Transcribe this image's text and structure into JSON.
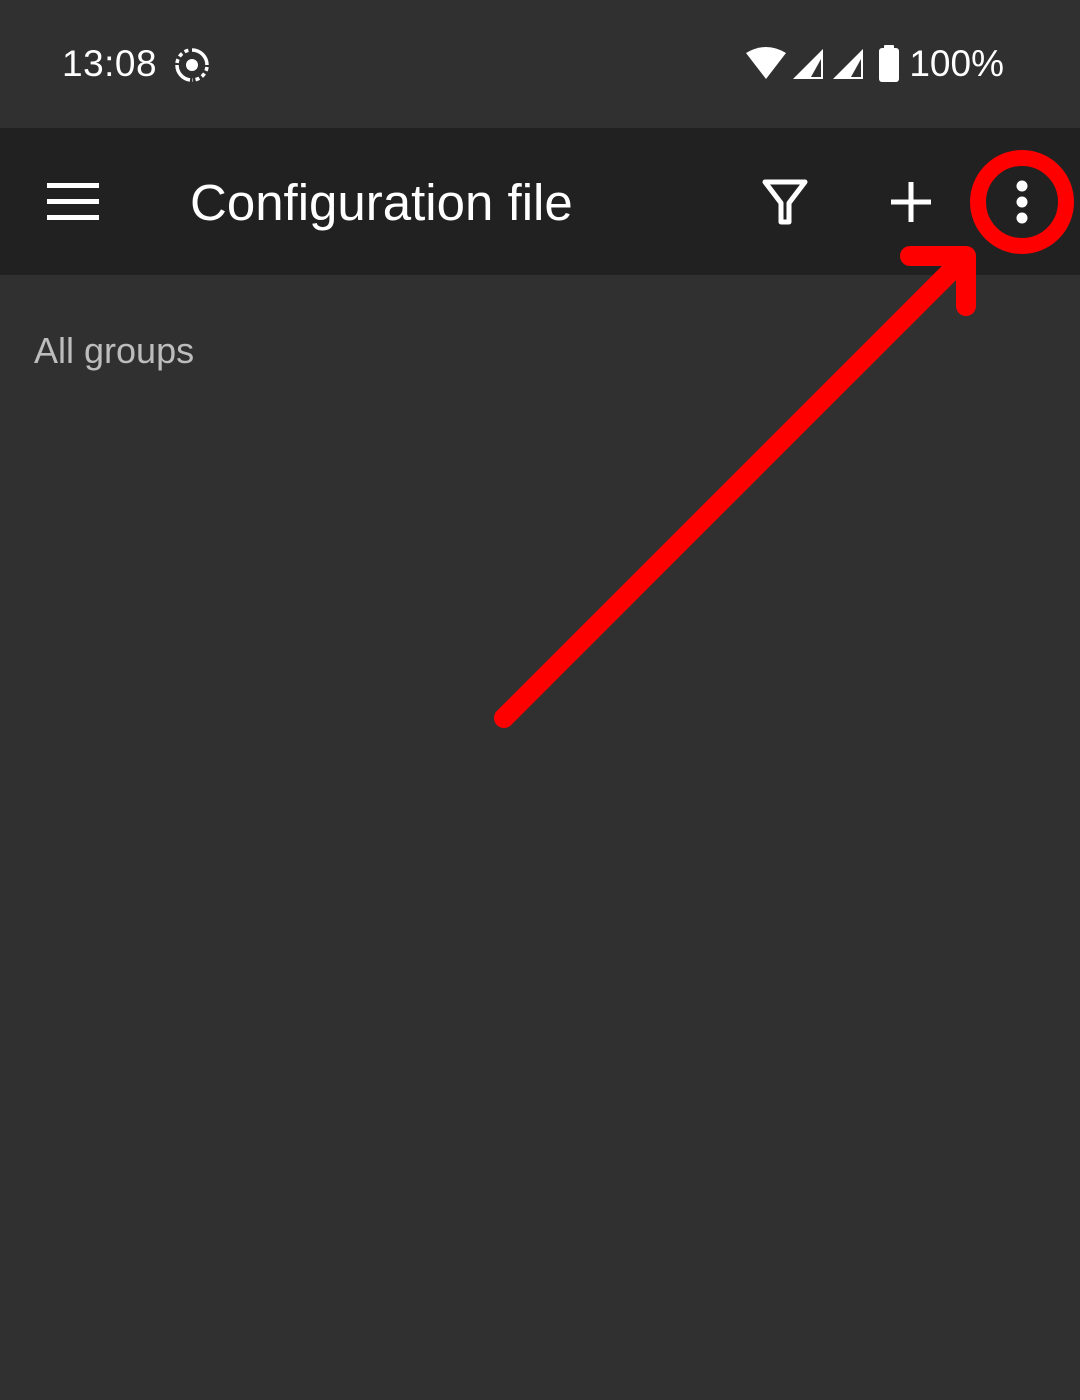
{
  "status_bar": {
    "time": "13:08",
    "cast_icon": "screen-record-icon",
    "wifi_icon": "wifi-icon",
    "signal_icon": "cell-signal-icon",
    "battery_icon": "battery-full-icon",
    "battery_percent": "100%"
  },
  "app_bar": {
    "title": "Configuration file",
    "menu_icon": "hamburger-menu-icon",
    "filter_icon": "filter-icon",
    "add_icon": "plus-icon",
    "overflow_icon": "more-vert-icon"
  },
  "content": {
    "section_label": "All groups"
  },
  "colors": {
    "background": "#303030",
    "app_bar": "#212121",
    "text_primary": "#ffffff",
    "text_secondary": "#bdbdbd",
    "annotation": "#ff0000"
  }
}
